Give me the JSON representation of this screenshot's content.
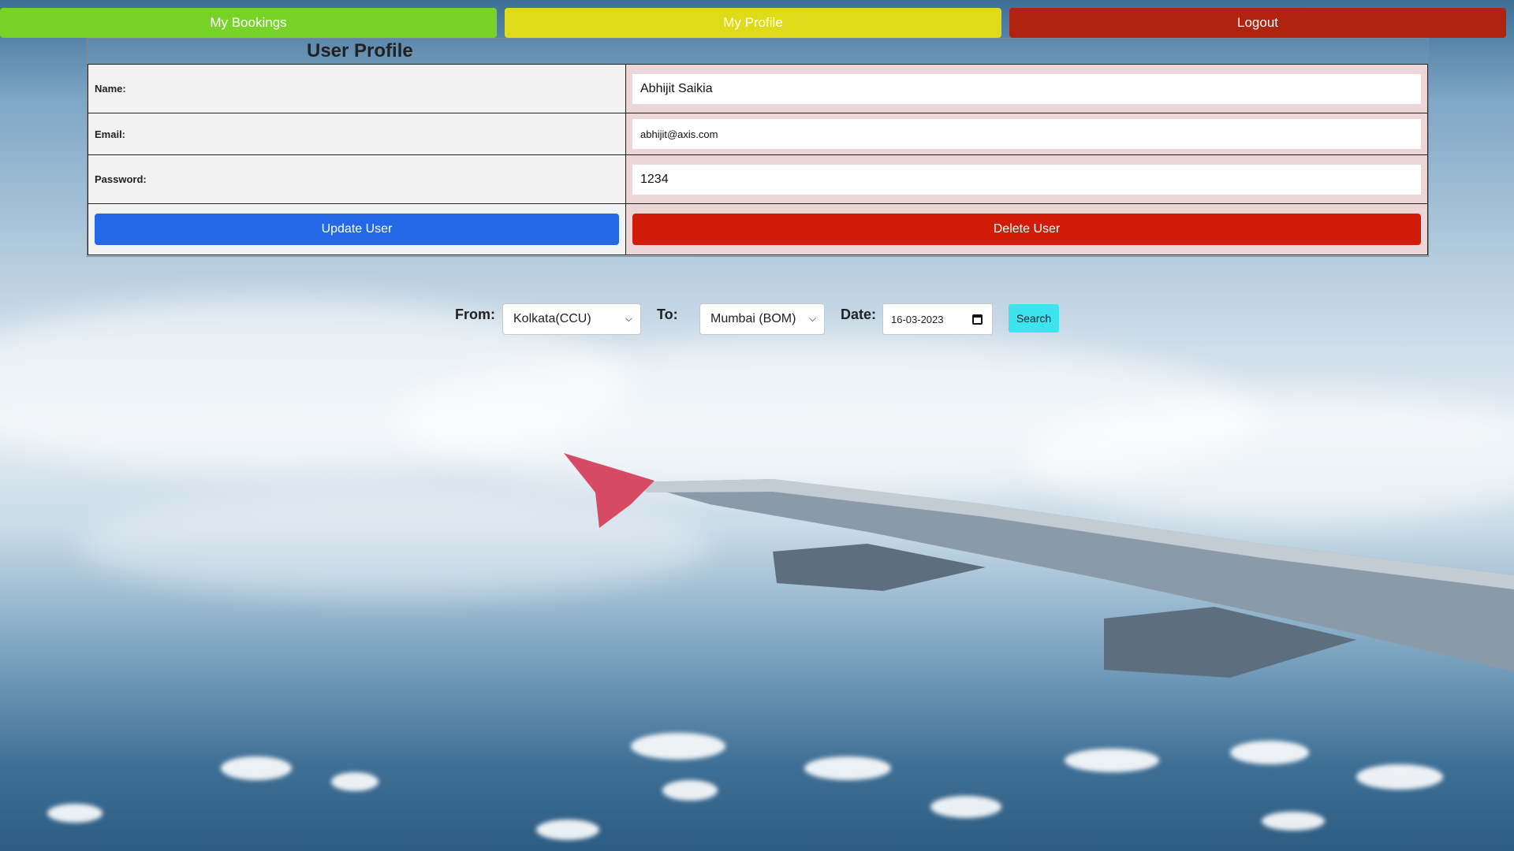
{
  "nav": {
    "bookings_label": "My Bookings",
    "profile_label": "My Profile",
    "logout_label": "Logout"
  },
  "profile": {
    "title": "User Profile",
    "name_label": "Name:",
    "name_value": "Abhijit Saikia",
    "email_label": "Email:",
    "email_value": "abhijit@axis.com",
    "password_label": "Password:",
    "password_value": "1234",
    "update_label": "Update User",
    "delete_label": "Delete User"
  },
  "search": {
    "from_label": "From:",
    "from_value": "Kolkata(CCU)",
    "to_label": "To:",
    "to_value": "Mumbai (BOM)",
    "date_label": "Date:",
    "date_value": "16-03-2023",
    "button_label": "Search"
  },
  "colors": {
    "bookings": "#77d327",
    "profile": "#dfdb18",
    "logout": "#b0230f",
    "update": "#2468e8",
    "delete": "#d21c0a",
    "search": "#3ee3f0"
  },
  "icons": {
    "select_chevron": "chevron-down-icon",
    "date_picker": "calendar-icon"
  }
}
